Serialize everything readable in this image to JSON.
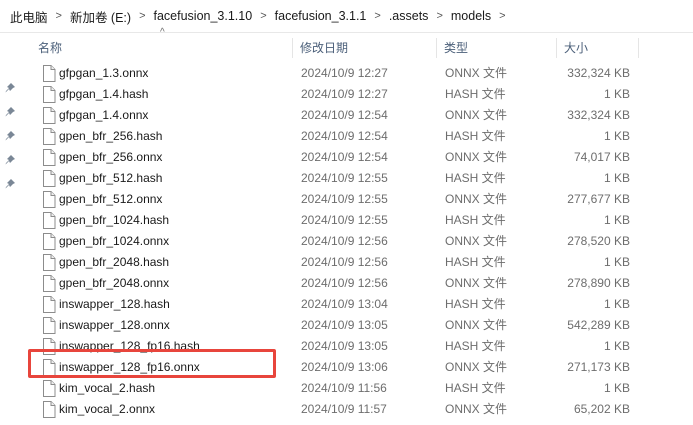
{
  "breadcrumb": [
    "此电脑",
    "新加卷 (E:)",
    "facefusion_3.1.10",
    "facefusion_3.1.1",
    ".assets",
    "models"
  ],
  "columns": {
    "name": "名称",
    "date": "修改日期",
    "type": "类型",
    "size": "大小"
  },
  "files": [
    {
      "name": "gfpgan_1.3.onnx",
      "date": "2024/10/9 12:27",
      "type": "ONNX 文件",
      "size": "332,324 KB"
    },
    {
      "name": "gfpgan_1.4.hash",
      "date": "2024/10/9 12:27",
      "type": "HASH 文件",
      "size": "1 KB"
    },
    {
      "name": "gfpgan_1.4.onnx",
      "date": "2024/10/9 12:54",
      "type": "ONNX 文件",
      "size": "332,324 KB"
    },
    {
      "name": "gpen_bfr_256.hash",
      "date": "2024/10/9 12:54",
      "type": "HASH 文件",
      "size": "1 KB"
    },
    {
      "name": "gpen_bfr_256.onnx",
      "date": "2024/10/9 12:54",
      "type": "ONNX 文件",
      "size": "74,017 KB"
    },
    {
      "name": "gpen_bfr_512.hash",
      "date": "2024/10/9 12:55",
      "type": "HASH 文件",
      "size": "1 KB"
    },
    {
      "name": "gpen_bfr_512.onnx",
      "date": "2024/10/9 12:55",
      "type": "ONNX 文件",
      "size": "277,677 KB"
    },
    {
      "name": "gpen_bfr_1024.hash",
      "date": "2024/10/9 12:55",
      "type": "HASH 文件",
      "size": "1 KB"
    },
    {
      "name": "gpen_bfr_1024.onnx",
      "date": "2024/10/9 12:56",
      "type": "ONNX 文件",
      "size": "278,520 KB"
    },
    {
      "name": "gpen_bfr_2048.hash",
      "date": "2024/10/9 12:56",
      "type": "HASH 文件",
      "size": "1 KB"
    },
    {
      "name": "gpen_bfr_2048.onnx",
      "date": "2024/10/9 12:56",
      "type": "ONNX 文件",
      "size": "278,890 KB"
    },
    {
      "name": "inswapper_128.hash",
      "date": "2024/10/9 13:04",
      "type": "HASH 文件",
      "size": "1 KB"
    },
    {
      "name": "inswapper_128.onnx",
      "date": "2024/10/9 13:05",
      "type": "ONNX 文件",
      "size": "542,289 KB"
    },
    {
      "name": "inswapper_128_fp16.hash",
      "date": "2024/10/9 13:05",
      "type": "HASH 文件",
      "size": "1 KB"
    },
    {
      "name": "inswapper_128_fp16.onnx",
      "date": "2024/10/9 13:06",
      "type": "ONNX 文件",
      "size": "271,173 KB"
    },
    {
      "name": "kim_vocal_2.hash",
      "date": "2024/10/9 11:56",
      "type": "HASH 文件",
      "size": "1 KB"
    },
    {
      "name": "kim_vocal_2.onnx",
      "date": "2024/10/9 11:57",
      "type": "ONNX 文件",
      "size": "65,202 KB"
    }
  ],
  "highlight_color": "#e8453c"
}
